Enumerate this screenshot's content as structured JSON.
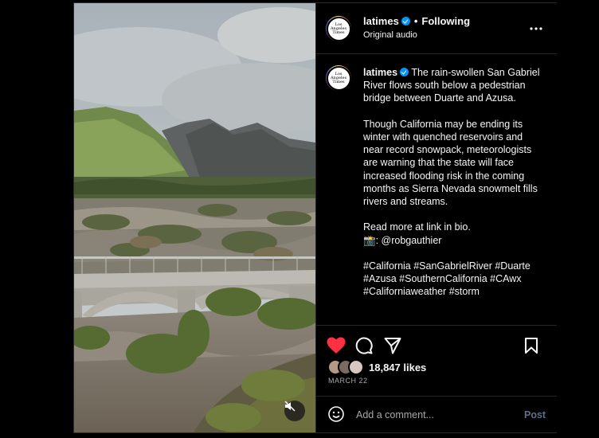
{
  "post": {
    "account": {
      "username": "latimes",
      "verified": true,
      "logo_text": [
        "Los",
        "Angeles",
        "Times"
      ],
      "follow_state": "Following",
      "separator": "•",
      "audio": "Original audio"
    },
    "caption_text": " The rain-swollen San Gabriel River flows south below a pedestrian bridge between Duarte and Azusa.\n\nThough California may be ending its winter with quenched reservoirs and near record snowpack, meteorologists are warning that the state will face increased flooding risk in the coming months as Sierra Nevada snowmelt fills rivers and streams.\n\nRead more at link in bio.\n📸: @robgauthier\n\n#California #SanGabrielRiver #Duarte #Azusa #SouthernCalifornia #CAwx #Californiaweather #storm",
    "likes": "18,847 likes",
    "date": "MARCH 22",
    "liked": true
  },
  "comment": {
    "placeholder": "Add a comment...",
    "post_label": "Post"
  },
  "icons": {
    "more": "more-options-icon",
    "like": "heart-icon",
    "comment": "comment-icon",
    "share": "share-icon",
    "save": "bookmark-icon",
    "emoji": "emoji-icon",
    "mute": "speaker-muted-icon"
  },
  "colors": {
    "like": "#ff3040",
    "link": "#0095f6",
    "post_disabled": "#5d6f88",
    "background": "#000000"
  }
}
